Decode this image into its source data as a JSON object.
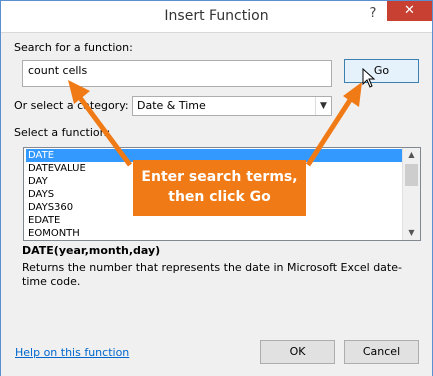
{
  "window": {
    "title": "Insert Function",
    "help_glyph": "?",
    "close_glyph": "✕"
  },
  "search": {
    "label": "Search for a function:",
    "value": "count cells",
    "go_label": "Go"
  },
  "category": {
    "label": "Or select a category:",
    "selected": "Date & Time"
  },
  "functions": {
    "label": "Select a function:",
    "items": [
      "DATE",
      "DATEVALUE",
      "DAY",
      "DAYS",
      "DAYS360",
      "EDATE",
      "EOMONTH"
    ],
    "selected_index": 0
  },
  "details": {
    "signature": "DATE(year,month,day)",
    "description": "Returns the number that represents the date in Microsoft Excel date-time code."
  },
  "footer": {
    "help_link": "Help on this function",
    "ok_label": "OK",
    "cancel_label": "Cancel"
  },
  "callout": {
    "line1": "Enter search terms,",
    "line2": "then click Go",
    "color": "#f07a16"
  }
}
